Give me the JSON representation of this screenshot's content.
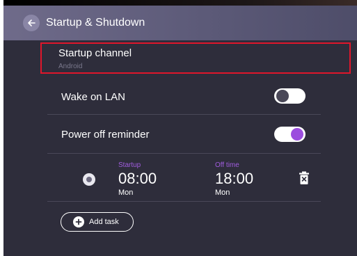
{
  "header": {
    "title": "Startup & Shutdown",
    "back_icon": "arrow-left-icon"
  },
  "settings": {
    "startup_channel": {
      "label": "Startup channel",
      "value": "Android"
    },
    "wake_on_lan": {
      "label": "Wake on LAN",
      "enabled": false
    },
    "power_off_reminder": {
      "label": "Power off reminder",
      "enabled": true
    }
  },
  "task": {
    "selected": true,
    "startup_label": "Startup",
    "startup_time": "08:00",
    "startup_day": "Mon",
    "off_label": "Off time",
    "off_time": "18:00",
    "off_day": "Mon",
    "delete_icon": "trash-icon"
  },
  "add_task": {
    "label": "Add task",
    "icon": "plus-circle-icon"
  },
  "colors": {
    "accent": "#9b4dde",
    "highlight_border": "#e0162b",
    "background": "#2e2d3b",
    "header": "#5b5977"
  }
}
